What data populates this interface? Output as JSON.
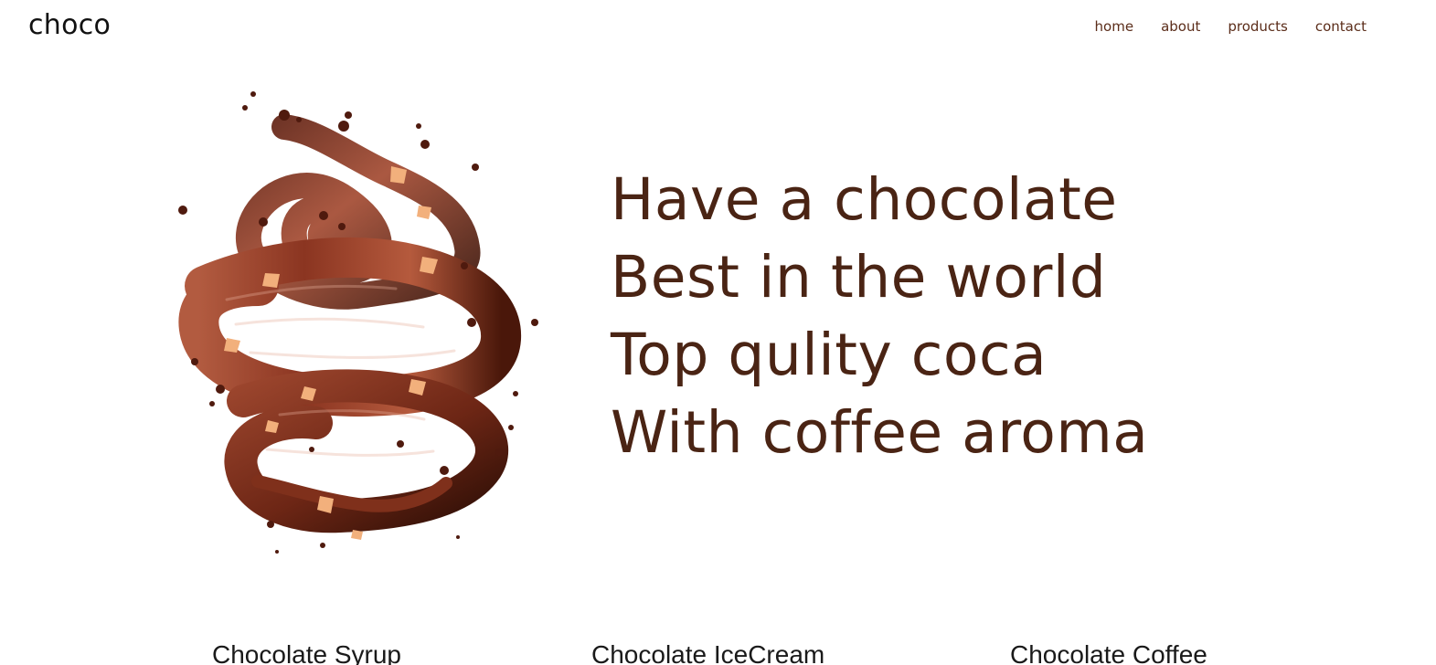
{
  "header": {
    "logo": "choco",
    "nav": [
      {
        "label": "home"
      },
      {
        "label": "about"
      },
      {
        "label": "products"
      },
      {
        "label": "contact"
      }
    ]
  },
  "hero": {
    "lines": [
      "Have a chocolate",
      "Best in the world",
      "Top qulity coca",
      "With coffee aroma"
    ],
    "image_icon": "chocolate-splash-image"
  },
  "products": [
    {
      "title": "Chocolate Syrup"
    },
    {
      "title": "Chocolate IceCream"
    },
    {
      "title": "Chocolate Coffee"
    }
  ],
  "colors": {
    "primary_text": "#4a2414",
    "nav_text": "#5b2d1a",
    "background": "#ffffff",
    "chocolate_dark": "#3b1409",
    "chocolate_mid": "#7a2f1c",
    "chocolate_light": "#b45a3f",
    "nut": "#f0a96b"
  }
}
